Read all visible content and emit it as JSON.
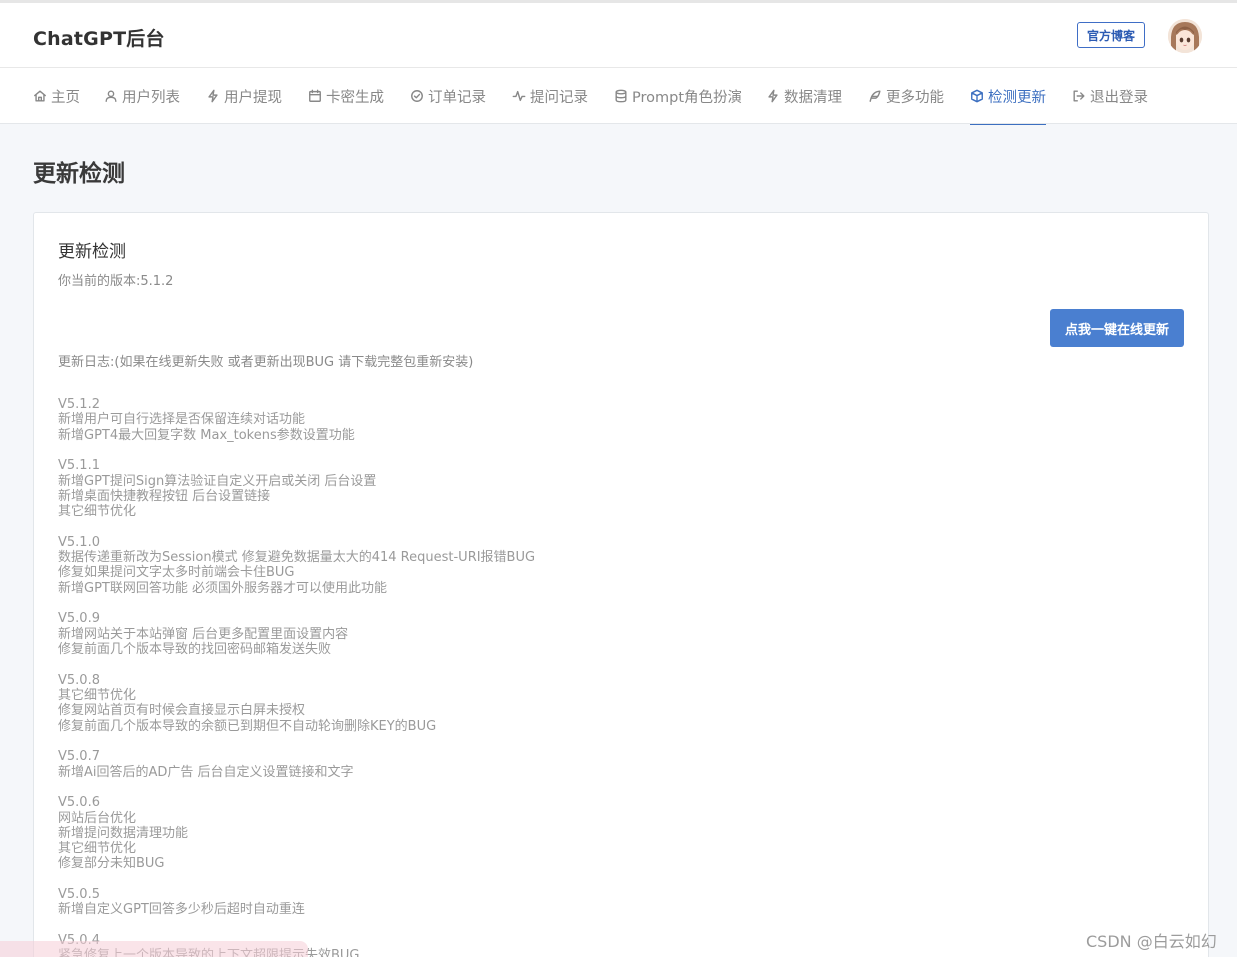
{
  "header": {
    "brand": "ChatGPT后台",
    "blog_button": "官方博客",
    "avatar_icon": "anime-avatar-icon"
  },
  "nav": {
    "items": [
      {
        "label": "主页",
        "icon": "home-icon"
      },
      {
        "label": "用户列表",
        "icon": "user-icon"
      },
      {
        "label": "用户提现",
        "icon": "bolt-icon"
      },
      {
        "label": "卡密生成",
        "icon": "calendar-icon"
      },
      {
        "label": "订单记录",
        "icon": "check-circle-icon"
      },
      {
        "label": "提问记录",
        "icon": "activity-icon"
      },
      {
        "label": "Prompt角色扮演",
        "icon": "database-icon"
      },
      {
        "label": "数据清理",
        "icon": "bolt-icon"
      },
      {
        "label": "更多功能",
        "icon": "feather-icon"
      },
      {
        "label": "检测更新",
        "icon": "box-icon",
        "active": true
      },
      {
        "label": "退出登录",
        "icon": "logout-icon"
      }
    ]
  },
  "page": {
    "title": "更新检测"
  },
  "card": {
    "title": "更新检测",
    "current_version": "你当前的版本:5.1.2",
    "update_button": "点我一键在线更新",
    "changelog_title": "更新日志:(如果在线更新失败 或者更新出现BUG 请下载完整包重新安装)",
    "changelog": [
      {
        "version": "V5.1.2",
        "lines": [
          "新增用户可自行选择是否保留连续对话功能",
          "新增GPT4最大回复字数 Max_tokens参数设置功能"
        ]
      },
      {
        "version": "V5.1.1",
        "lines": [
          "新增GPT提问Sign算法验证自定义开启或关闭 后台设置",
          "新增桌面快捷教程按钮 后台设置链接",
          "其它细节优化"
        ]
      },
      {
        "version": "V5.1.0",
        "lines": [
          "数据传递重新改为Session模式 修复避免数据量太大的414 Request-URI报错BUG",
          "修复如果提问文字太多时前端会卡住BUG",
          "新增GPT联网回答功能 必须国外服务器才可以使用此功能"
        ]
      },
      {
        "version": "V5.0.9",
        "lines": [
          "新增网站关于本站弹窗 后台更多配置里面设置内容",
          "修复前面几个版本导致的找回密码邮箱发送失败"
        ]
      },
      {
        "version": "V5.0.8",
        "lines": [
          "其它细节优化",
          "修复网站首页有时候会直接显示白屏未授权",
          "修复前面几个版本导致的余额已到期但不自动轮询删除KEY的BUG"
        ]
      },
      {
        "version": "V5.0.7",
        "lines": [
          "新增Ai回答后的AD广告 后台自定义设置链接和文字"
        ]
      },
      {
        "version": "V5.0.6",
        "lines": [
          "网站后台优化",
          "新增提问数据清理功能",
          "其它细节优化",
          "修复部分未知BUG"
        ]
      },
      {
        "version": "V5.0.5",
        "lines": [
          "新增自定义GPT回答多少秒后超时自动重连"
        ]
      },
      {
        "version": "V5.0.4",
        "lines": [
          "紧急修复上一个版本导致的上下文超限提示失效BUG"
        ]
      }
    ]
  },
  "watermark": "CSDN @白云如幻"
}
